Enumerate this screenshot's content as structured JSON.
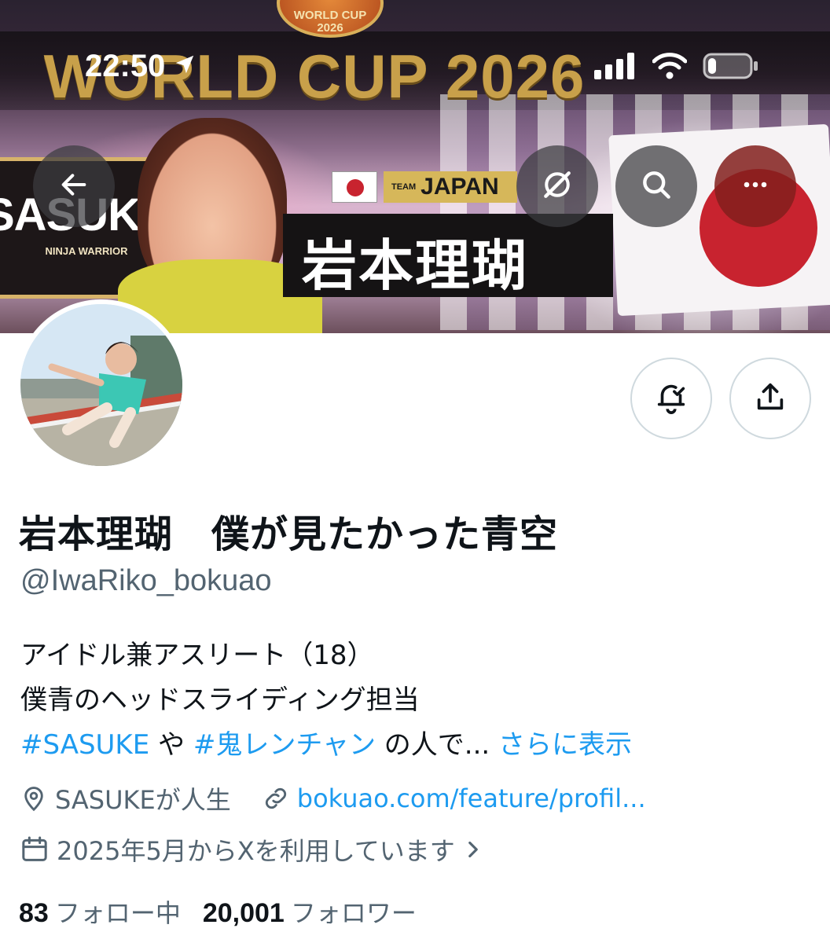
{
  "status_bar": {
    "time": "22:50",
    "location_icon": "location-arrow-icon",
    "signal_icon": "cellular-signal-icon",
    "wifi_icon": "wifi-icon",
    "battery_icon": "battery-icon",
    "battery_level": 0.2
  },
  "banner": {
    "ball_text_line1": "WORLD CUP",
    "ball_text_line2": "2026",
    "headline": "WORLD CUP 2026",
    "logo_text": "SASUKE",
    "logo_sub": "NINJA WARRIOR",
    "team_small": "TEAM",
    "team_big": "JAPAN",
    "name_plate": "岩本理瑚"
  },
  "toolbar": {
    "back_icon": "arrow-left-icon",
    "grok_icon": "grok-icon",
    "search_icon": "search-icon",
    "more_icon": "more-horizontal-icon"
  },
  "actions": {
    "notify_icon": "bell-check-icon",
    "share_icon": "share-upload-icon"
  },
  "profile": {
    "display_name": "岩本理瑚　僕が見たかった青空",
    "handle": "@IwaRiko_bokuao",
    "bio_line1": "アイドル兼アスリート（18）",
    "bio_line2": "僕青のヘッドスライディング担当",
    "bio_tag1": "#SASUKE",
    "bio_joiner": " や ",
    "bio_tag2": "#鬼レンチャン",
    "bio_tail": " の人で... ",
    "bio_more": "さらに表示",
    "location": "SASUKEが人生",
    "website": "bokuao.com/feature/profil...",
    "joined": "2025年5月からXを利用しています",
    "following_count": "83",
    "following_label": "フォロー中",
    "followers_count": "20,001",
    "followers_label": "フォロワー"
  },
  "colors": {
    "accent": "#1d9bf0",
    "text_primary": "#0f1419",
    "text_secondary": "#536471",
    "border": "#cfd9de"
  }
}
